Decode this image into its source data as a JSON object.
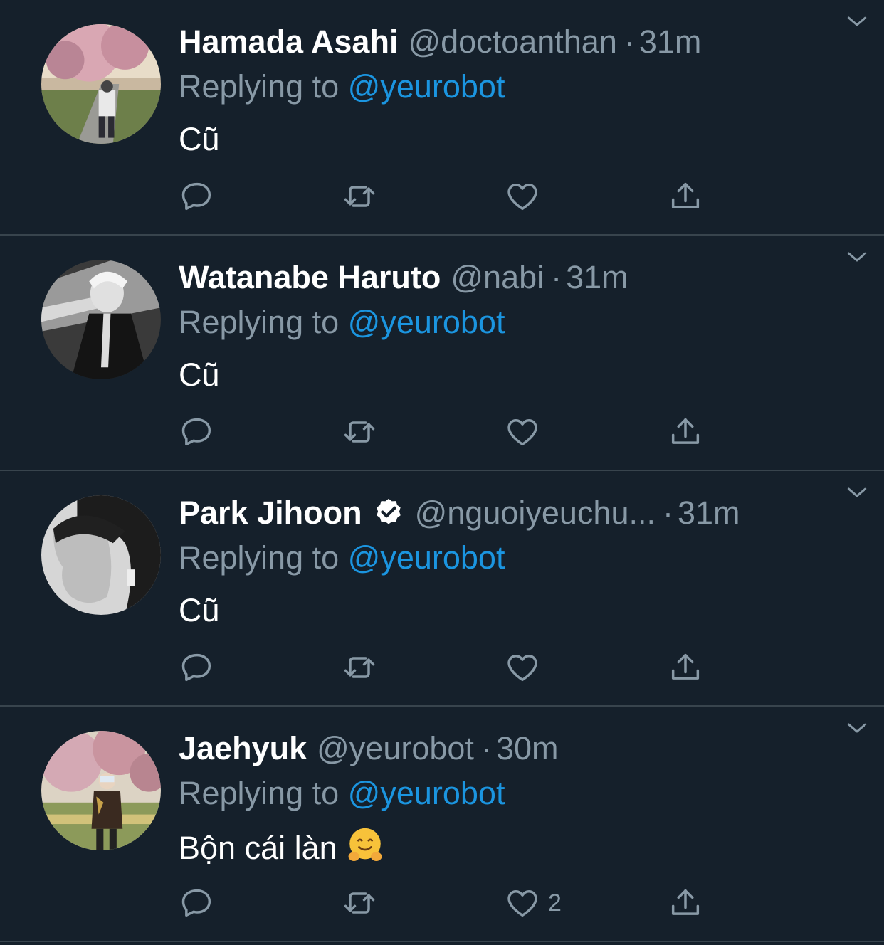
{
  "reply_prefix": "Replying to",
  "colors": {
    "background": "#15202b",
    "secondary_text": "#8899a6",
    "link": "#1b95e0",
    "divider": "#38444d"
  },
  "tweets": [
    {
      "name": "Hamada Asahi",
      "handle": "@doctoanthan",
      "separator": "·",
      "time": "31m",
      "verified": false,
      "replying_to": "@yeurobot",
      "text": "Cũ",
      "like_count": "",
      "avatar": "avatar-cherry-blossom-bike"
    },
    {
      "name": "Watanabe Haruto",
      "handle": "@nabi",
      "separator": "·",
      "time": "31m",
      "verified": false,
      "replying_to": "@yeurobot",
      "text": "Cũ",
      "like_count": "",
      "avatar": "avatar-bw-suit"
    },
    {
      "name": "Park Jihoon",
      "handle": "@nguoiyeuchu...",
      "separator": "·",
      "time": "31m",
      "verified": true,
      "replying_to": "@yeurobot",
      "text": "Cũ",
      "like_count": "",
      "avatar": "avatar-bw-profile"
    },
    {
      "name": "Jaehyuk",
      "handle": "@yeurobot",
      "separator": "·",
      "time": "30m",
      "verified": false,
      "replying_to": "@yeurobot",
      "text": "Bộn cái làn",
      "emoji": "hugging-face-emoji",
      "like_count": "2",
      "avatar": "avatar-cherry-blossom-standing"
    }
  ]
}
